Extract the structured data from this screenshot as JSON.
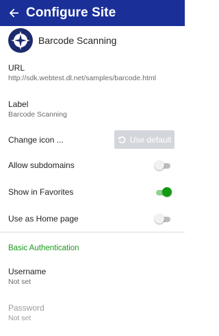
{
  "appbar": {
    "title": "Configure Site",
    "back_icon": "arrow-left-icon"
  },
  "site": {
    "name": "Barcode Scanning",
    "icon": "compass-star-icon"
  },
  "url": {
    "label": "URL",
    "value": "http://sdk.webtest.dl.net/samples/barcode.html"
  },
  "label_field": {
    "label": "Label",
    "value": "Barcode Scanning"
  },
  "change_icon": {
    "label": "Change icon ...",
    "button_label": "Use default",
    "button_icon": "undo-icon",
    "button_enabled": false
  },
  "toggles": {
    "allow_subdomains": {
      "label": "Allow subdomains",
      "on": false
    },
    "show_in_favorites": {
      "label": "Show in Favorites",
      "on": true
    },
    "home_page": {
      "label": "Use as Home page",
      "on": false
    }
  },
  "basic_auth": {
    "title": "Basic Authentication",
    "username": {
      "label": "Username",
      "value": "Not set"
    },
    "password": {
      "label": "Password",
      "value": "Not set",
      "enabled": false
    }
  },
  "colors": {
    "appbar": "#1a2f98",
    "accent_green": "#129a12",
    "section_green": "#1a9a1a"
  }
}
